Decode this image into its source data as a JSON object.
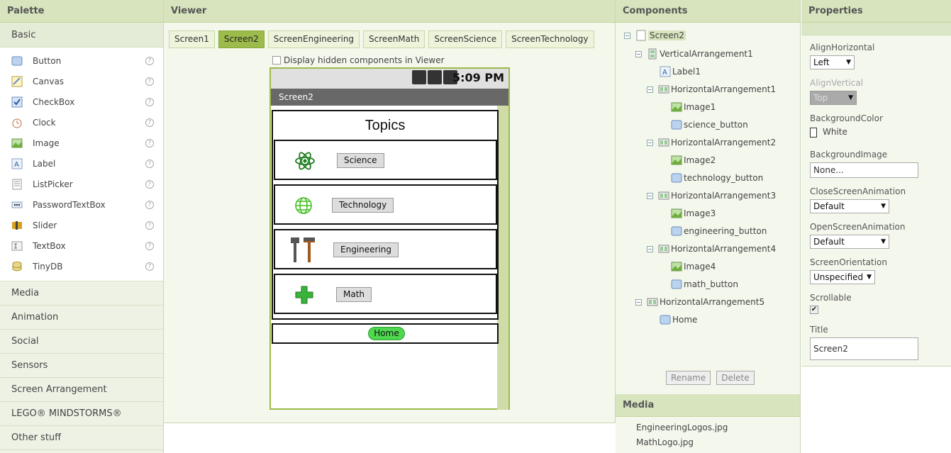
{
  "palette": {
    "header": "Palette",
    "basic_label": "Basic",
    "items": [
      {
        "label": "Button",
        "icon": "button-icon"
      },
      {
        "label": "Canvas",
        "icon": "canvas-icon"
      },
      {
        "label": "CheckBox",
        "icon": "checkbox-icon"
      },
      {
        "label": "Clock",
        "icon": "clock-icon"
      },
      {
        "label": "Image",
        "icon": "image-icon"
      },
      {
        "label": "Label",
        "icon": "label-icon"
      },
      {
        "label": "ListPicker",
        "icon": "listpicker-icon"
      },
      {
        "label": "PasswordTextBox",
        "icon": "password-icon"
      },
      {
        "label": "Slider",
        "icon": "slider-icon"
      },
      {
        "label": "TextBox",
        "icon": "textbox-icon"
      },
      {
        "label": "TinyDB",
        "icon": "tinydb-icon"
      }
    ],
    "help_glyph": "?",
    "categories": [
      "Media",
      "Animation",
      "Social",
      "Sensors",
      "Screen Arrangement",
      "LEGO® MINDSTORMS®",
      "Other stuff"
    ]
  },
  "viewer": {
    "header": "Viewer",
    "tabs": [
      "Screen1",
      "Screen2",
      "ScreenEngineering",
      "ScreenMath",
      "ScreenScience",
      "ScreenTechnology"
    ],
    "active_tab": "Screen2",
    "hidden_label": "Display hidden components in Viewer",
    "phone": {
      "time": "5:09 PM",
      "title": "Screen2",
      "topics": "Topics",
      "buttons": [
        "Science",
        "Technology",
        "Engineering",
        "Math"
      ],
      "home": "Home"
    }
  },
  "components": {
    "header": "Components",
    "tree": [
      {
        "label": "Screen2",
        "toggle": "⊟",
        "icon": "screen-icon",
        "selected": true
      },
      {
        "label": "VerticalArrangement1",
        "toggle": "⊟",
        "icon": "vertical-arrangement-icon"
      },
      {
        "label": "Label1",
        "icon": "label-icon"
      },
      {
        "label": "HorizontalArrangement1",
        "toggle": "⊟",
        "icon": "horizontal-arrangement-icon"
      },
      {
        "label": "Image1",
        "icon": "image-icon"
      },
      {
        "label": "science_button",
        "icon": "button-icon"
      },
      {
        "label": "HorizontalArrangement2",
        "toggle": "⊟",
        "icon": "horizontal-arrangement-icon"
      },
      {
        "label": "Image2",
        "icon": "image-icon"
      },
      {
        "label": "technology_button",
        "icon": "button-icon"
      },
      {
        "label": "HorizontalArrangement3",
        "toggle": "⊟",
        "icon": "horizontal-arrangement-icon"
      },
      {
        "label": "Image3",
        "icon": "image-icon"
      },
      {
        "label": "engineering_button",
        "icon": "button-icon"
      },
      {
        "label": "HorizontalArrangement4",
        "toggle": "⊟",
        "icon": "horizontal-arrangement-icon"
      },
      {
        "label": "Image4",
        "icon": "image-icon"
      },
      {
        "label": "math_button",
        "icon": "button-icon"
      },
      {
        "label": "HorizontalArrangement5",
        "toggle": "⊟",
        "icon": "horizontal-arrangement-icon"
      },
      {
        "label": "Home",
        "icon": "button-icon"
      }
    ],
    "rename_label": "Rename",
    "delete_label": "Delete"
  },
  "media": {
    "header": "Media",
    "files": [
      "EngineeringLogos.jpg",
      "MathLogo.jpg"
    ]
  },
  "properties": {
    "header": "Properties",
    "align_horizontal": {
      "label": "AlignHorizontal",
      "value": "Left"
    },
    "align_vertical": {
      "label": "AlignVertical",
      "value": "Top"
    },
    "background_color": {
      "label": "BackgroundColor",
      "value": "White"
    },
    "background_image": {
      "label": "BackgroundImage",
      "value": "None..."
    },
    "close_anim": {
      "label": "CloseScreenAnimation",
      "value": "Default"
    },
    "open_anim": {
      "label": "OpenScreenAnimation",
      "value": "Default"
    },
    "orientation": {
      "label": "ScreenOrientation",
      "value": "Unspecified"
    },
    "scrollable": {
      "label": "Scrollable",
      "checked": true,
      "glyph": "✔"
    },
    "title": {
      "label": "Title",
      "value": "Screen2"
    }
  },
  "colors": {
    "header_bg": "#d7e4bd",
    "active_tab": "#9cbb4b",
    "home_button": "#4fd84f"
  }
}
